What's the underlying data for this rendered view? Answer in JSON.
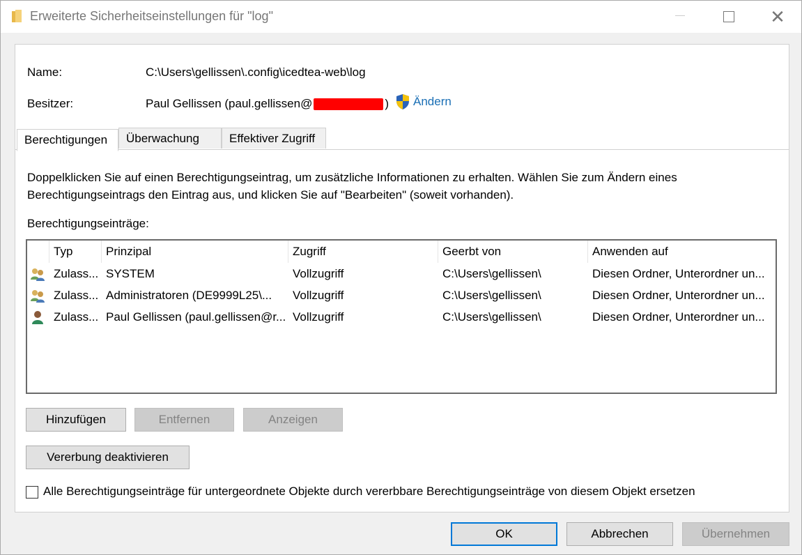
{
  "window": {
    "title": "Erweiterte Sicherheitseinstellungen für \"log\"",
    "minimize": "—",
    "close": "✕"
  },
  "header": {
    "name_label": "Name:",
    "name_value": "C:\\Users\\gellissen\\.config\\icedtea-web\\log",
    "owner_label": "Besitzer:",
    "owner_value_prefix": "Paul Gellissen (paul.gellissen@",
    "owner_value_suffix": ")",
    "change_label": "Ändern"
  },
  "tabs": [
    {
      "label": "Berechtigungen",
      "active": true
    },
    {
      "label": "Überwachung",
      "active": false
    },
    {
      "label": "Effektiver Zugriff",
      "active": false
    }
  ],
  "info_text": "Doppelklicken Sie auf einen Berechtigungseintrag, um zusätzliche Informationen zu erhalten. Wählen Sie zum Ändern eines Berechtigungseintrags den Eintrag aus, und klicken Sie auf \"Bearbeiten\" (soweit vorhanden).",
  "entries_label": "Berechtigungseinträge:",
  "table": {
    "columns": [
      "Typ",
      "Prinzipal",
      "Zugriff",
      "Geerbt von",
      "Anwenden auf"
    ],
    "rows": [
      {
        "icon": "group-users-icon",
        "typ": "Zulass...",
        "prinzipal": "SYSTEM",
        "zugriff": "Vollzugriff",
        "geerbt": "C:\\Users\\gellissen\\",
        "anwenden": "Diesen Ordner, Unterordner un..."
      },
      {
        "icon": "group-users-icon",
        "typ": "Zulass...",
        "prinzipal": "Administratoren (DE9999L25\\...",
        "zugriff": "Vollzugriff",
        "geerbt": "C:\\Users\\gellissen\\",
        "anwenden": "Diesen Ordner, Unterordner un..."
      },
      {
        "icon": "single-user-icon",
        "typ": "Zulass...",
        "prinzipal": "Paul Gellissen (paul.gellissen@r...",
        "zugriff": "Vollzugriff",
        "geerbt": "C:\\Users\\gellissen\\",
        "anwenden": "Diesen Ordner, Unterordner un..."
      }
    ]
  },
  "buttons": {
    "add": "Hinzufügen",
    "remove": "Entfernen",
    "view": "Anzeigen",
    "disable_inheritance": "Vererbung deaktivieren",
    "ok": "OK",
    "cancel": "Abbrechen",
    "apply": "Übernehmen"
  },
  "replace_checkbox": {
    "label": "Alle Berechtigungseinträge für untergeordnete Objekte durch vererbbare Berechtigungseinträge von diesem Objekt ersetzen",
    "checked": false
  },
  "colors": {
    "link": "#1a6fb5",
    "redaction": "#ff0000",
    "default_button_border": "#0078d7"
  }
}
